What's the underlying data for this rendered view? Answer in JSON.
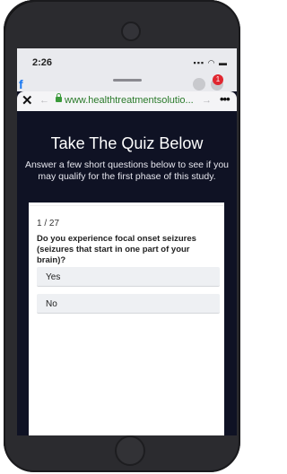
{
  "status": {
    "time": "2:26",
    "icons": "signal wifi battery"
  },
  "background_app": {
    "logo_text": "facebook",
    "badge": "1"
  },
  "browser": {
    "close_label": "✕",
    "back_label": "←",
    "url": "www.healthtreatmentsolutio...",
    "forward_label": "→",
    "more_label": "•••"
  },
  "page": {
    "title": "Take The Quiz Below",
    "subtitle": "Answer a few short questions below to see if you may qualify for the first phase of this study."
  },
  "quiz": {
    "counter": "1 / 27",
    "question": "Do you experience focal onset seizures (seizures that start in one part of your brain)?",
    "answers": [
      {
        "label": "Yes"
      },
      {
        "label": "No"
      }
    ]
  }
}
